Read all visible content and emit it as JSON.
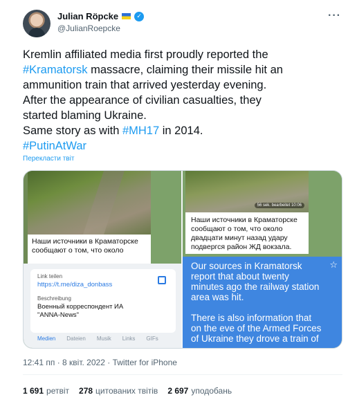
{
  "author": {
    "display_name": "Julian Röpcke",
    "handle": "@JulianRoepcke",
    "more_label": "···"
  },
  "tweet": {
    "lines": [
      {
        "before": "Kremlin affiliated media first proudly reported the",
        "link": "",
        "after": ""
      },
      {
        "before": "",
        "link": "#Kramatorsk",
        "after": " massacre, claiming their missile hit an"
      },
      {
        "before": "ammunition train that arrived yesterday evening.",
        "link": "",
        "after": ""
      },
      {
        "before": "After the appearance of civilian casualties, they",
        "link": "",
        "after": ""
      },
      {
        "before": "started blaming Ukraine.",
        "link": "",
        "after": ""
      },
      {
        "before": "Same story as with ",
        "link": "#MH17",
        "after": " in 2014."
      },
      {
        "before": "",
        "link": "#PutinAtWar",
        "after": ""
      }
    ],
    "translate_label": "Перекласти твіт"
  },
  "media": {
    "left_caption": "Наши источники в Краматорске сообщают о том, что около",
    "link_card": {
      "label_link": "Link teilen",
      "url": "https://t.me/diza_donbass",
      "label_desc": "Beschreibung",
      "desc": "Военный корреспондент ИА \"ANNA-News\""
    },
    "tabs": [
      "Medien",
      "Dateien",
      "Musik",
      "Links",
      "GIFs"
    ],
    "right_badge": "56 sek. bearbeitet 10:06",
    "right_caption": "Наши источники в Краматорске сообщают о том, что около двадцати минут назад удару подвергся район ЖД вокзала.",
    "blue_lines_1": [
      "Our sources in Kramatorsk",
      "report that about twenty",
      "minutes ago the railway station",
      "area was hit."
    ],
    "blue_lines_2": [
      "There is also information that",
      "on the eve of the Armed Forces",
      "of Ukraine they drove a train of"
    ]
  },
  "meta": {
    "time": "12:41 пп",
    "date": "8 квіт. 2022",
    "source": "Twitter for iPhone"
  },
  "stats": [
    {
      "count": "1 691",
      "label": "ретвіт"
    },
    {
      "count": "278",
      "label": "цитованих твітів"
    },
    {
      "count": "2 697",
      "label": "уподобань"
    }
  ],
  "colors": {
    "link": "#1d9bf0",
    "verified": "#1d9bf0",
    "translation_box": "#3f86e0"
  }
}
